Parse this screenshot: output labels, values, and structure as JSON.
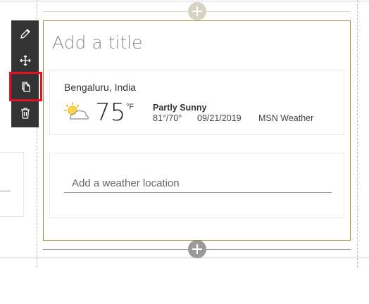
{
  "webpart": {
    "title_placeholder": "Add a title"
  },
  "toolbar": {
    "items": [
      {
        "name": "edit",
        "icon": "pencil-icon"
      },
      {
        "name": "move",
        "icon": "move-arrows-icon"
      },
      {
        "name": "duplicate",
        "icon": "copy-icon",
        "selected": true
      },
      {
        "name": "delete",
        "icon": "trash-icon"
      }
    ]
  },
  "weather": {
    "city": "Bengaluru, India",
    "temperature": "75",
    "unit": "°F",
    "condition": "Partly Sunny",
    "high_low": "81°/70°",
    "date": "09/21/2019",
    "source": "MSN Weather",
    "icon": "partly-sunny-icon"
  },
  "location": {
    "placeholder": "Add a weather location"
  },
  "colors": {
    "toolbar_bg": "#333333",
    "selection_outline": "#e81123",
    "webpart_border": "#a28d3b",
    "plus_top": "#d8d3c4",
    "plus_bottom": "#9a9a9a"
  }
}
